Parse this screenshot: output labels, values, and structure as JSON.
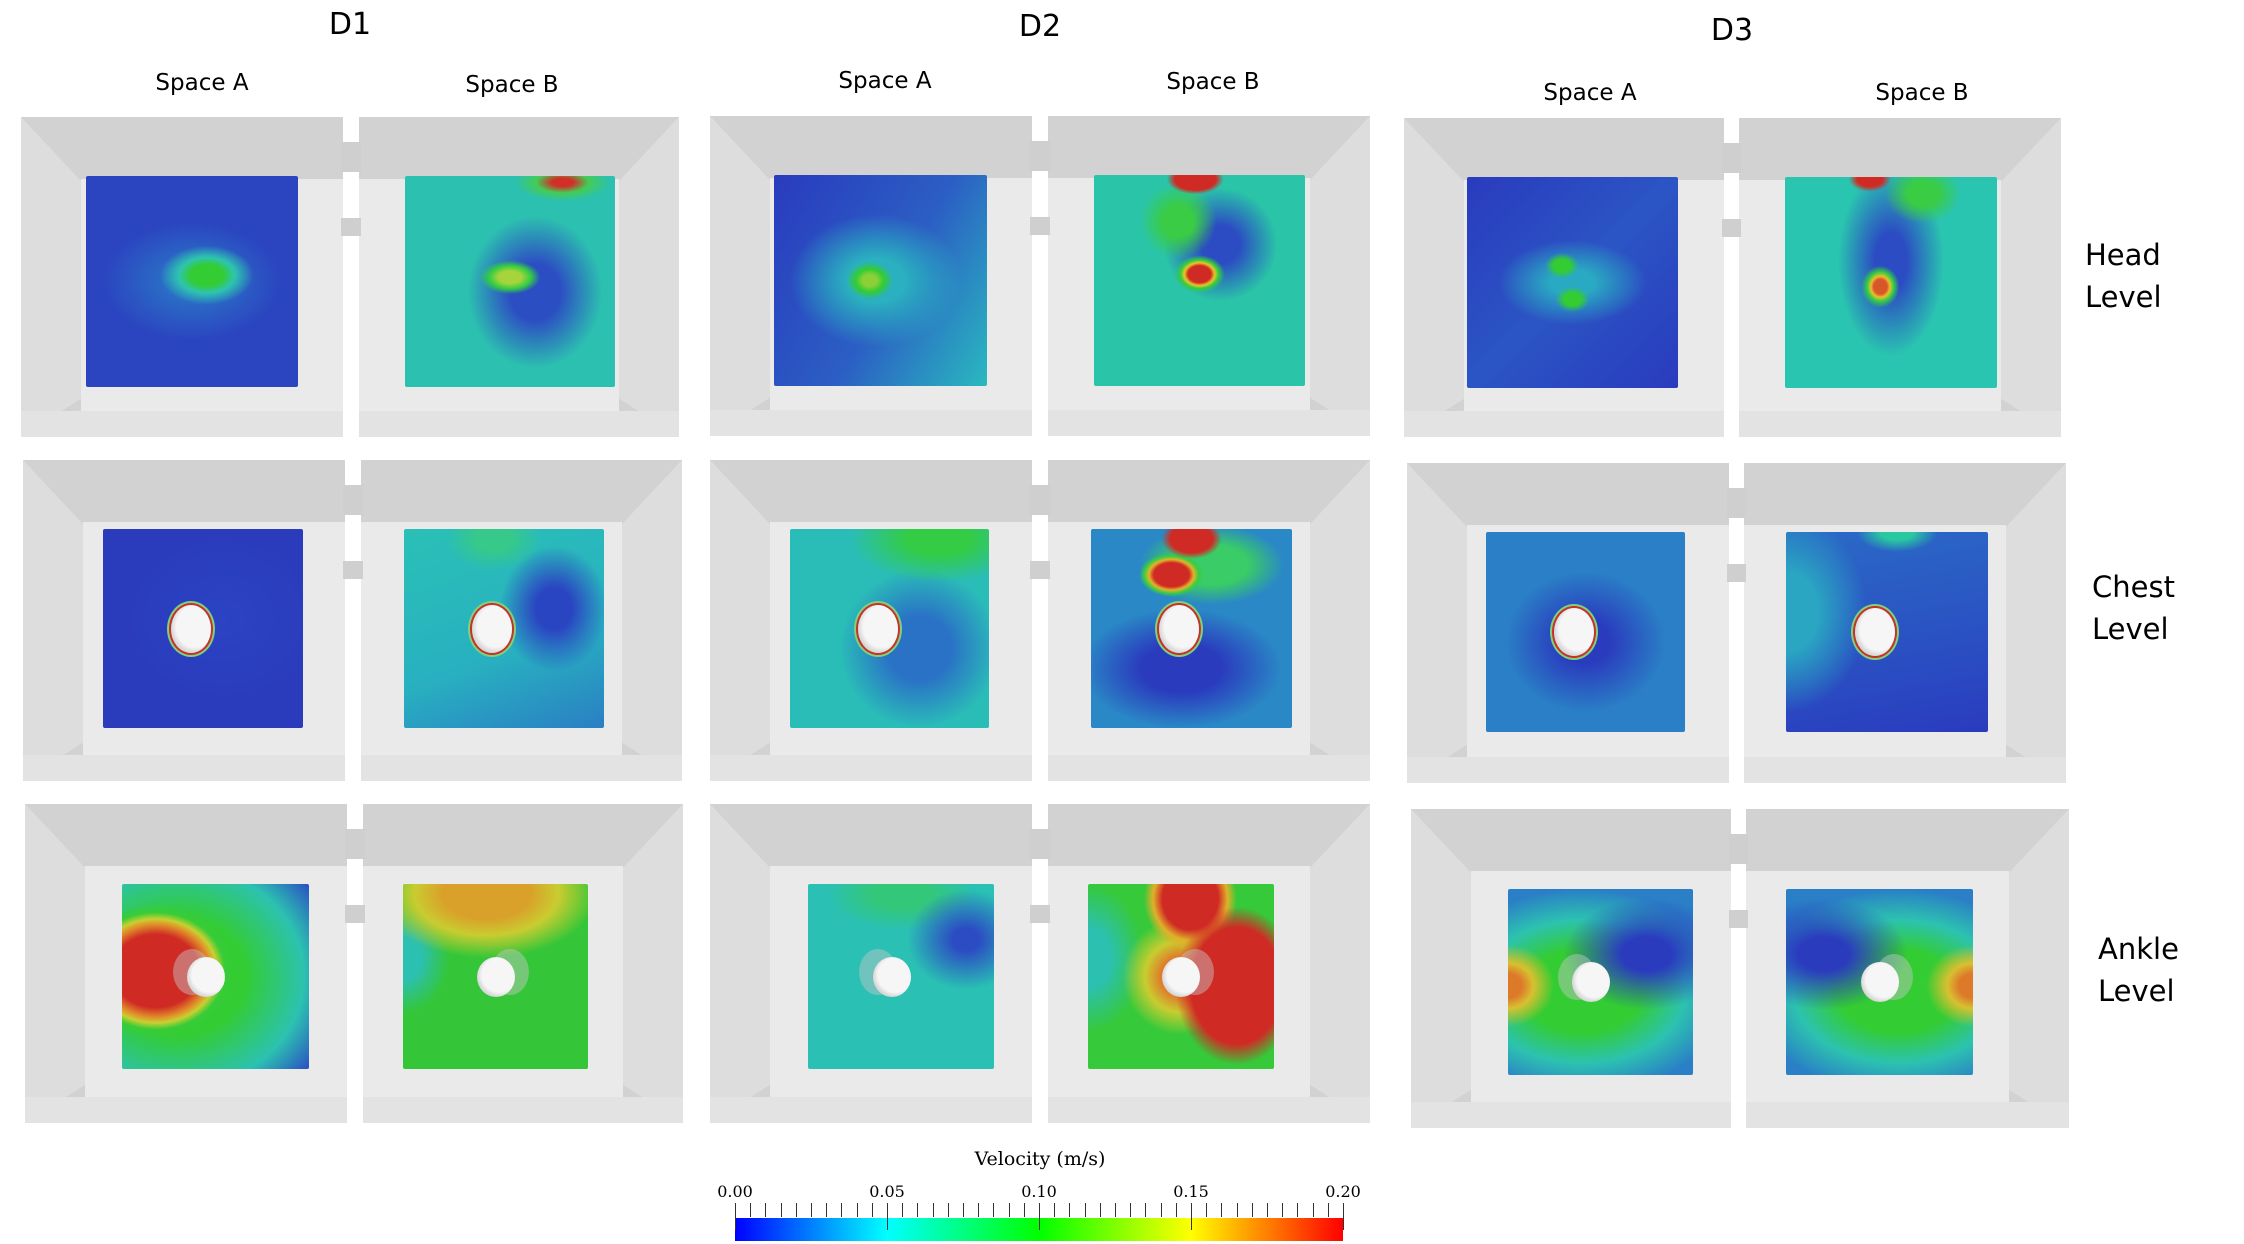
{
  "columns": [
    {
      "id": "D1",
      "title": "D1",
      "spaces": [
        "Space A",
        "Space B"
      ]
    },
    {
      "id": "D2",
      "title": "D2",
      "spaces": [
        "Space A",
        "Space B"
      ]
    },
    {
      "id": "D3",
      "title": "D3",
      "spaces": [
        "Space A",
        "Space B"
      ]
    }
  ],
  "rows": [
    {
      "id": "head",
      "label_line1": "Head",
      "label_line2": "Level"
    },
    {
      "id": "chest",
      "label_line1": "Chest",
      "label_line2": "Level"
    },
    {
      "id": "ankle",
      "label_line1": "Ankle",
      "label_line2": "Level"
    }
  ],
  "colorbar": {
    "title": "Velocity (m/s)",
    "min": 0.0,
    "max": 0.2,
    "major_ticks": [
      "0.00",
      "0.05",
      "0.10",
      "0.15",
      "0.20"
    ],
    "minor_step": 0.005,
    "colormap": [
      "#0000ff",
      "#00ffff",
      "#00ff00",
      "#ffff00",
      "#ff0000"
    ]
  },
  "chart_data": {
    "type": "heatmap",
    "title": "Velocity (m/s)",
    "value_range": [
      0.0,
      0.2
    ],
    "columns": [
      "D1",
      "D2",
      "D3"
    ],
    "subcolumns": [
      "Space A",
      "Space B"
    ],
    "rows": [
      "Head Level",
      "Chest Level",
      "Ankle Level"
    ],
    "panels_dominant_level": {
      "D1": {
        "head": {
          "Space A": "low",
          "Space B": "low-medium"
        },
        "chest": {
          "Space A": "low",
          "Space B": "low-medium"
        },
        "ankle": {
          "Space A": "high",
          "Space B": "medium-high"
        }
      },
      "D2": {
        "head": {
          "Space A": "low",
          "Space B": "medium"
        },
        "chest": {
          "Space A": "low-medium",
          "Space B": "low with high plume"
        },
        "ankle": {
          "Space A": "low-medium",
          "Space B": "high"
        }
      },
      "D3": {
        "head": {
          "Space A": "low",
          "Space B": "low-medium"
        },
        "chest": {
          "Space A": "low",
          "Space B": "low"
        },
        "ankle": {
          "Space A": "medium",
          "Space B": "medium"
        }
      }
    }
  }
}
